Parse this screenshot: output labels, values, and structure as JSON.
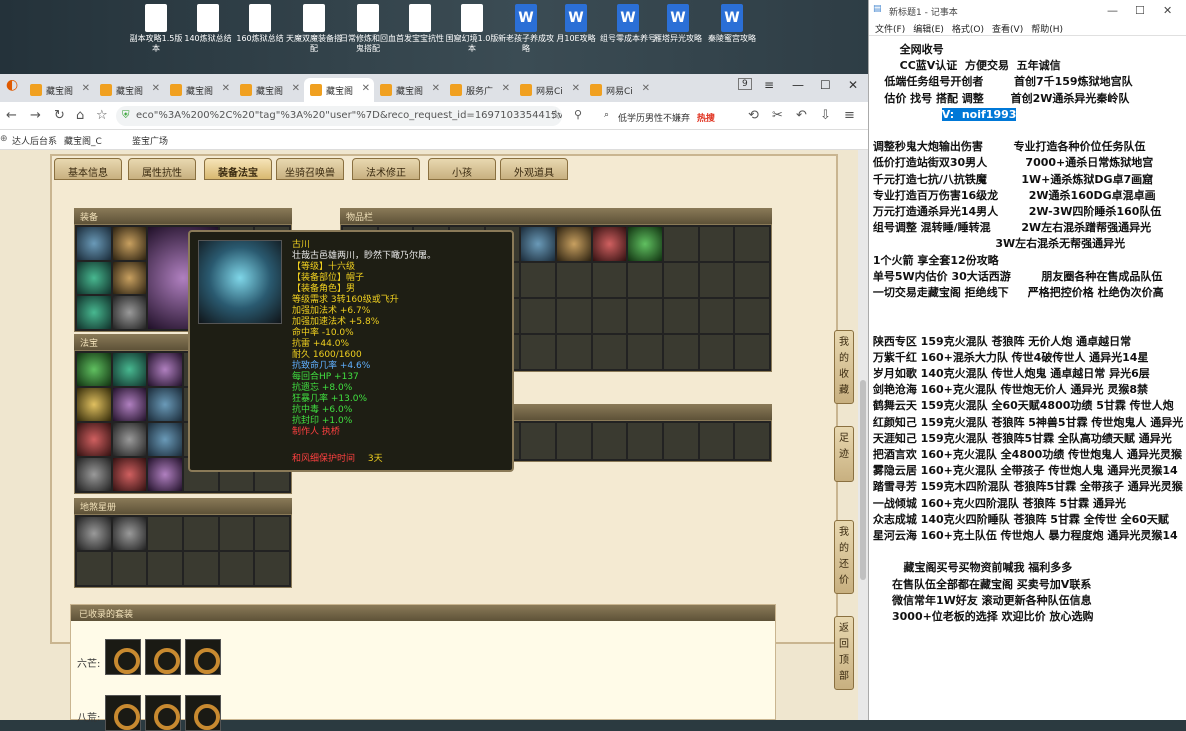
{
  "desktop": {
    "icons": [
      {
        "label": "副本攻略1.5版本",
        "type": "doc"
      },
      {
        "label": "140炼狱总结",
        "type": "doc"
      },
      {
        "label": "160炼狱总结",
        "type": "doc"
      },
      {
        "label": "天魔双魔装备搭配",
        "type": "doc"
      },
      {
        "label": "日常修炼和回血鬼搭配",
        "type": "doc"
      },
      {
        "label": "首发宝宝抗性",
        "type": "doc"
      },
      {
        "label": "国窟幻境1.0版本",
        "type": "doc"
      },
      {
        "label": "新老孩子养成攻略",
        "type": "word"
      },
      {
        "label": "月10E攻略",
        "type": "word"
      },
      {
        "label": "组号零成本养号",
        "type": "word"
      },
      {
        "label": "雁塔异光攻略",
        "type": "word"
      },
      {
        "label": "秦陵蜜宫攻略",
        "type": "word"
      }
    ]
  },
  "browser": {
    "tabs": [
      {
        "label": "藏宝阁"
      },
      {
        "label": "藏宝阁"
      },
      {
        "label": "藏宝阁"
      },
      {
        "label": "藏宝阁"
      },
      {
        "label": "藏宝阁",
        "active": true
      },
      {
        "label": "藏宝阁"
      },
      {
        "label": "服务广"
      },
      {
        "label": "网易Ci"
      },
      {
        "label": "网易Ci"
      }
    ],
    "tab_count": "9",
    "url": "eco\"%3A%200%2C%20\"tag\"%3A%20\"user\"%7D&reco_request_id=1697103354415vE_TJ",
    "search_text": "低学历男性不嫌弃",
    "hot_label": "热搜",
    "bookmarks": [
      "达人后台系",
      "藏宝阁_C",
      "鉴宝广场"
    ]
  },
  "game": {
    "tabs": [
      "基本信息",
      "属性抗性",
      "装备法宝",
      "坐骑召唤兽",
      "法术修正",
      "小孩",
      "外观道具"
    ],
    "active_tab": "装备法宝",
    "panels": {
      "equipment": "装备",
      "treasure": "法宝",
      "talisman": "地煞星册",
      "inventory": "物品栏",
      "collection": "已收录的套装"
    },
    "tooltip": {
      "lines": [
        {
          "text": "古川",
          "color": "y"
        },
        {
          "text": "壮哉古邑雄两川，眇然下瞰乃尔屠。",
          "color": "w"
        },
        {
          "text": "【等级】十六级",
          "color": "y"
        },
        {
          "text": "【装备部位】帽子",
          "color": "y"
        },
        {
          "text": "【装备角色】男",
          "color": "y"
        },
        {
          "text": "等级需求 3转160级或飞升",
          "color": "y"
        },
        {
          "text": "加强加法术 +6.7%",
          "color": "y"
        },
        {
          "text": "加强加速法术 +5.8%",
          "color": "y"
        },
        {
          "text": "命中率 -10.0%",
          "color": "y"
        },
        {
          "text": "抗雷 +44.0%",
          "color": "y"
        },
        {
          "text": "耐久 1600/1600",
          "color": "y"
        },
        {
          "text": "抗致命几率 +4.6%",
          "color": "b"
        },
        {
          "text": "每回合HP +137",
          "color": "g"
        },
        {
          "text": "抗遗忘 +8.0%",
          "color": "g"
        },
        {
          "text": "狂暴几率 +13.0%",
          "color": "g"
        },
        {
          "text": "抗中毒 +6.0%",
          "color": "g"
        },
        {
          "text": "抗封印 +1.0%",
          "color": "g"
        },
        {
          "text": "制作人 执桥",
          "color": "r"
        }
      ],
      "protect_label": "和风细保护时间",
      "protect_value": "3天"
    },
    "side_buttons": [
      "我的收藏",
      "足迹",
      "我的还价",
      "返回顶部"
    ],
    "collection_rows": [
      {
        "label": "六芒:"
      },
      {
        "label": "八荒:"
      }
    ]
  },
  "notepad": {
    "title": "新标题1 - 记事本",
    "menu": [
      "文件(F)",
      "编辑(E)",
      "格式(O)",
      "查看(V)",
      "帮助(H)"
    ],
    "lines": [
      "        全网收号",
      "        CC蓝V认证  方便交易  五年诚信",
      "    低端任务组号开创者        首创7千159炼狱地宫队",
      "    估价 找号 搭配 调整       首创2W通杀异光秦岭队",
      "                   V:  noif1993",
      "",
      " 调整秒鬼大炮输出伤害        专业打造各种价位任务队伍",
      " 低价打造站街双30男人          7000+通杀日常炼狱地宫",
      " 千元打造七抗/八抗铁魔         1W+通杀炼狱DG卓7画窟",
      " 专业打造百万伤害16级龙        2W通杀160DG卓混卓画",
      " 万元打造通杀异光14男人        2W-3W四阶睡杀160队伍",
      " 组号调整 混转睡/睡转混        2W左右混杀蹭帮强通异光",
      "                                 3W左右混杀无帮强通异光",
      " 1个火箭 享全套12份攻略",
      " 单号5W内估价 30大话西游        朋友圈各种在售成品队伍",
      " 一切交易走藏宝阁 拒绝线下     严格把控价格 杜绝伪次价高",
      "",
      "",
      " 陕西专区 159克火混队 苍狼阵 无价人炮 通卓越日常",
      " 万紫千红 160+混杀大力队 传世4破传世人 通异光14星",
      " 岁月如歌 140克火混队 传世人炮鬼 通卓越日常 异光6层",
      " 剑艳沧海 160+克火混队 传世炮无价人 通异光 灵猴8禁",
      " 鹤舞云天 159克火混队 全60天赋4800功绩 5甘霖 传世人炮",
      " 红颜知己 159克火混队 苍狼阵 5神兽5甘霖 传世炮鬼人 通异光",
      " 天涯知己 159克火混队 苍狼阵5甘霖 全队高功绩天赋 通异光",
      " 把酒言欢 160+克火混队 全4800功绩 传世炮鬼人 通异光灵猴",
      " 雾隐云居 160+克火混队 全带孩子 传世炮人鬼 通异光灵猴14",
      " 踏雪寻芳 159克木四阶混队 苍狼阵5甘霖 全带孩子 通异光灵猴",
      " 一战倾城 160+克火四阶混队 苍狼阵 5甘霖 通异光",
      " 众志成城 140克火四阶睡队 苍狼阵 5甘霖 全传世 全60天赋",
      " 星河云海 160+克土队伍 传世炮人 暴力程度炮 通异光灵猴14",
      "",
      "         藏宝阁买号买物资前喊我 福利多多",
      "      在售队伍全部都在藏宝阁 买卖号加V联系",
      "      微信常年1W好友 滚动更新各种队伍信息",
      "      3000+位老板的选择 欢迎比价 放心选购"
    ]
  }
}
